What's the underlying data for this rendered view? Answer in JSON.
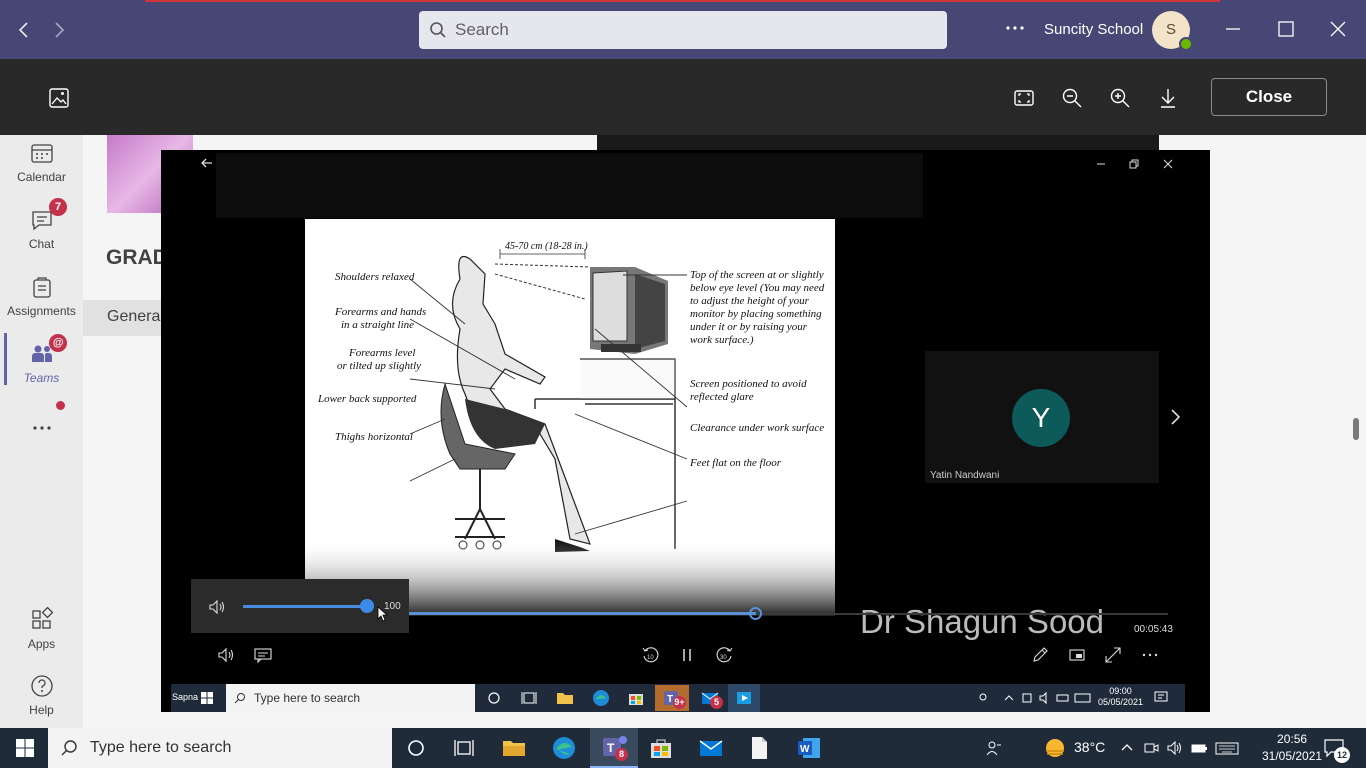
{
  "titlebar": {
    "search_placeholder": "Search",
    "org_name": "Suncity School",
    "avatar_initial": "S"
  },
  "viewer": {
    "close_label": "Close"
  },
  "rail": {
    "items": [
      {
        "label": "Calendar",
        "icon": "calendar-icon"
      },
      {
        "label": "Chat",
        "icon": "chat-icon",
        "badge": "7"
      },
      {
        "label": "Assignments",
        "icon": "assignments-icon"
      },
      {
        "label": "Teams",
        "icon": "teams-icon",
        "badge": "@"
      },
      {
        "label": "Apps",
        "icon": "apps-icon"
      },
      {
        "label": "Help",
        "icon": "help-icon"
      }
    ]
  },
  "background": {
    "team_heading": "GRAD",
    "channel_tab": "Genera"
  },
  "video": {
    "slide": {
      "measurement": "45-70 cm (18-28 in.)",
      "left_labels": [
        "Shoulders relaxed",
        "Forearms and hands",
        "in a straight line",
        "Forearms level",
        "or tilted up slightly",
        "Lower back supported",
        "Thighs horizontal"
      ],
      "right_labels": [
        "Top of the screen at or slightly",
        "below eye level (You may need",
        "to adjust the height of your",
        "monitor by placing something",
        "under it or by raising your",
        "work surface.)",
        "Screen positioned to avoid",
        "reflected glare",
        "Clearance under work surface",
        "Feet flat on the floor"
      ]
    },
    "participant_initial": "Y",
    "participant_name": "Yatin Nandwani",
    "watermark": "Dr Shagun Sood",
    "elapsed": "00:05:43",
    "volume": "100",
    "volume_fraction": 1.0,
    "progress_fraction": 0.46,
    "inner_taskbar": {
      "user": "Sapna",
      "search_placeholder": "Type here to search",
      "time": "09:00",
      "date": "05/05/2021",
      "teams_badge": "9+",
      "mail_badge": "5"
    }
  },
  "taskbar": {
    "search_placeholder": "Type here to search",
    "temperature": "38°C",
    "time": "20:56",
    "date": "31/05/2021",
    "teams_badge": "8",
    "notification_count": "12"
  }
}
